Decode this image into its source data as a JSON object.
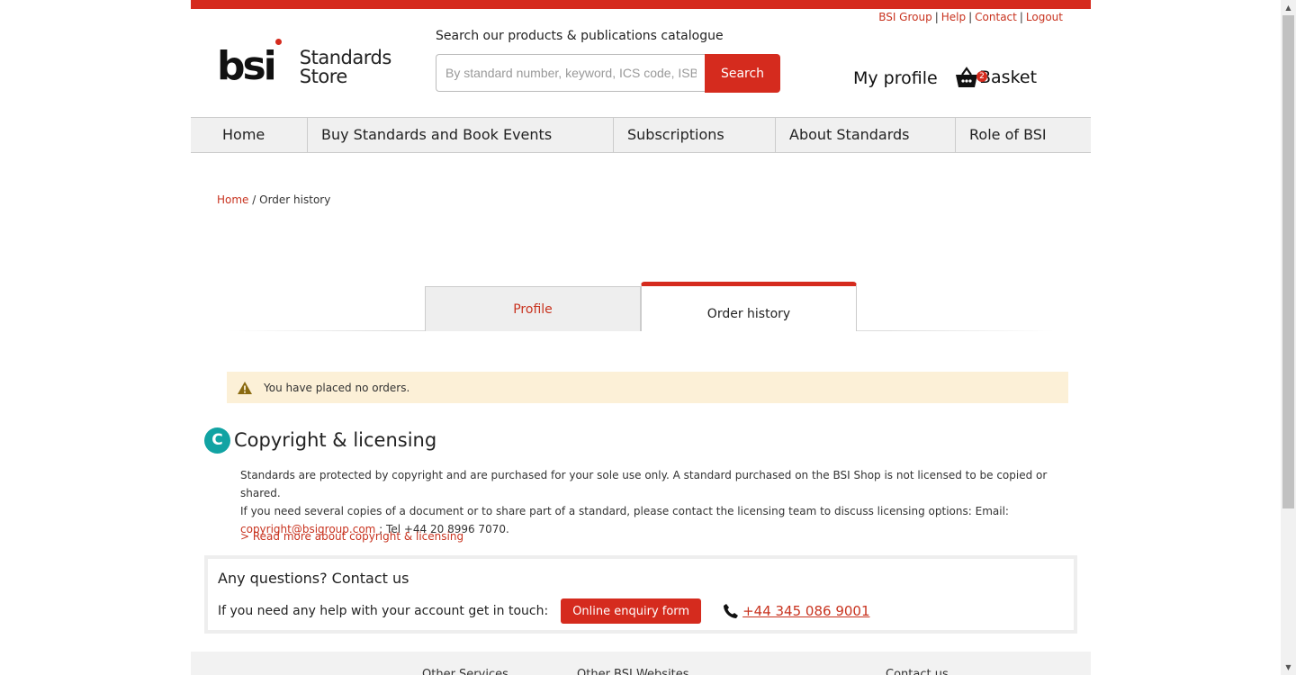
{
  "header": {
    "util_links": [
      "BSI Group",
      "Help",
      "Contact",
      "Logout"
    ],
    "logo_text": "bsi",
    "logo_subtitle_line1": "Standards",
    "logo_subtitle_line2": "Store",
    "search_label": "Search our products & publications catalogue",
    "search_placeholder": "By standard number, keyword, ICS code, ISBN",
    "search_button": "Search",
    "my_profile": "My profile",
    "basket_label": "Basket",
    "basket_count": "2"
  },
  "nav": {
    "items": [
      "Home",
      "Buy Standards and Book Events",
      "Subscriptions",
      "About Standards",
      "Role of BSI"
    ]
  },
  "breadcrumb": {
    "home": "Home",
    "separator": "/",
    "current": "Order history"
  },
  "tabs": {
    "profile": "Profile",
    "order_history": "Order history"
  },
  "alert": {
    "message": "You have placed no orders."
  },
  "copyright": {
    "badge": "C",
    "title": "Copyright & licensing",
    "line1": "Standards are protected by copyright and are purchased for your sole use only. A standard purchased on the BSI Shop is not licensed to be copied or shared.",
    "line2": "If you need several copies of a document or to share part of a standard, please contact the licensing team to discuss licensing options: Email:",
    "email": "copyright@bsigroup.com",
    "tel": " ; Tel +44 20 8996 7070.",
    "read_more": "> Read more about copyright & licensing"
  },
  "contact": {
    "title": "Any questions? Contact us",
    "text": "If you need any help with your account get in touch:",
    "button": "Online enquiry form",
    "phone": "+44 345 086 9001"
  },
  "footer": {
    "columns": [
      "Other Services",
      "Other BSI Websites",
      "Contact us"
    ]
  },
  "colors": {
    "brand_red": "#d52b1e",
    "teal": "#11a3a3",
    "alert_bg": "#fcf0d7"
  }
}
